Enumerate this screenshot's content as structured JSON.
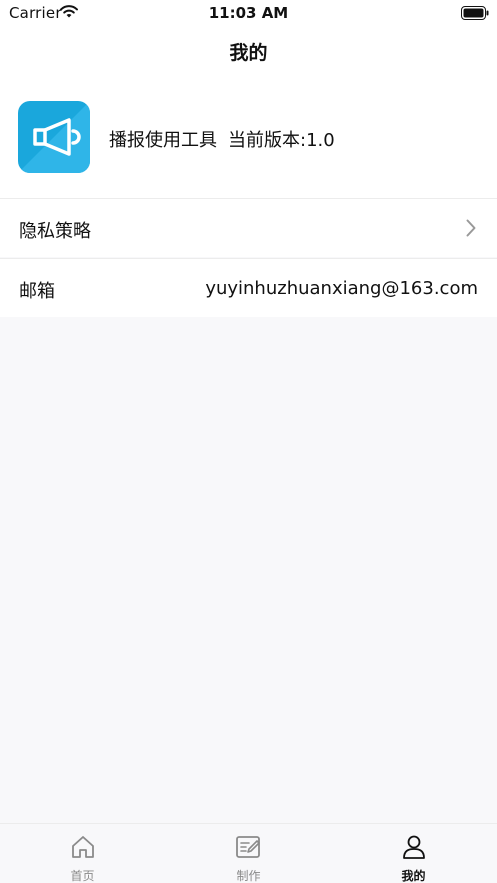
{
  "status_bar": {
    "carrier": "Carrier",
    "time": "11:03 AM",
    "icons": [
      "wifi-icon",
      "battery-icon"
    ]
  },
  "nav": {
    "title": "我的"
  },
  "app_info": {
    "icon": "megaphone-icon",
    "icon_color": "#1aa7dc",
    "name": "播报使用工具",
    "version": "当前版本:1.0"
  },
  "rows": {
    "privacy": {
      "label": "隐私策略",
      "icon": "chevron-right-icon"
    },
    "email": {
      "label": "邮箱",
      "value": "yuyinhuzhuanxiang@163.com"
    }
  },
  "tab_bar": {
    "tabs": [
      {
        "label": "首页",
        "icon": "home-icon",
        "selected": false
      },
      {
        "label": "制作",
        "icon": "edit-icon",
        "selected": false
      },
      {
        "label": "我的",
        "icon": "person-icon",
        "selected": true
      }
    ],
    "selected_color": "#111111",
    "unselected_color": "#8a8a8a"
  }
}
